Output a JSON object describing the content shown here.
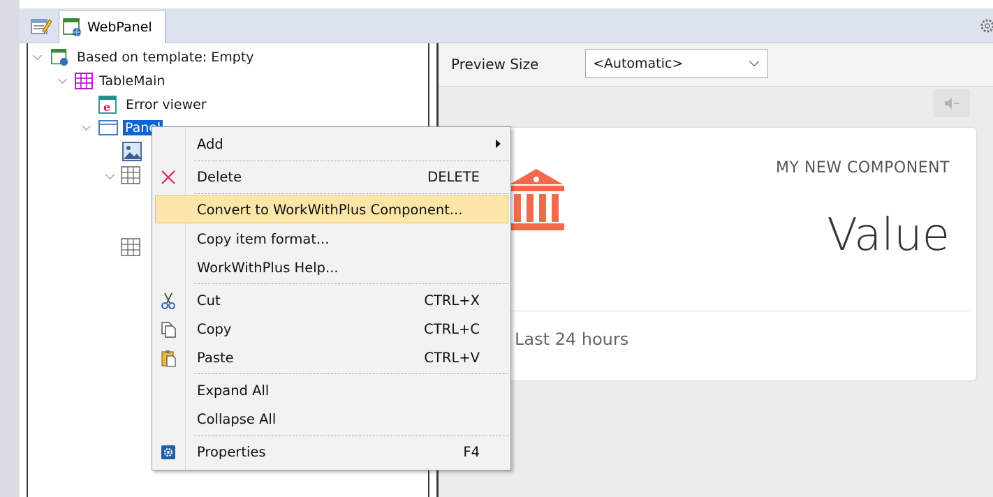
{
  "tabs": {
    "properties_icon": "properties-icon",
    "active_tab_label": "WebPanel"
  },
  "tree": {
    "root_label": "Based on template: Empty",
    "table_main_label": "TableMain",
    "error_viewer_label": "Error viewer",
    "panel_label": "Panel"
  },
  "preview": {
    "size_label": "Preview Size",
    "size_value": "<Automatic>",
    "card_title": "MY NEW COMPONENT",
    "card_value": "Value",
    "card_footer": "Last 24 hours",
    "accent_color": "#f26a4b"
  },
  "context_menu": {
    "items": [
      {
        "label": "Add",
        "shortcut": ""
      },
      {
        "label": "Delete",
        "shortcut": "DELETE"
      },
      {
        "label": "Convert to WorkWithPlus Component...",
        "shortcut": ""
      },
      {
        "label": "Copy item format...",
        "shortcut": ""
      },
      {
        "label": "WorkWithPlus Help...",
        "shortcut": ""
      },
      {
        "label": "Cut",
        "shortcut": "CTRL+X"
      },
      {
        "label": "Copy",
        "shortcut": "CTRL+C"
      },
      {
        "label": "Paste",
        "shortcut": "CTRL+V"
      },
      {
        "label": "Expand All",
        "shortcut": ""
      },
      {
        "label": "Collapse All",
        "shortcut": ""
      },
      {
        "label": "Properties",
        "shortcut": "F4"
      }
    ]
  }
}
